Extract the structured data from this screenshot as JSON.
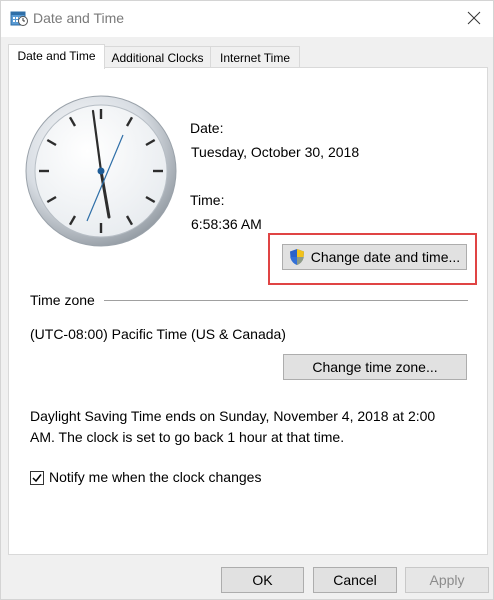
{
  "window": {
    "title": "Date and Time"
  },
  "tabs": [
    {
      "label": "Date and Time"
    },
    {
      "label": "Additional Clocks"
    },
    {
      "label": "Internet Time"
    }
  ],
  "date_section": {
    "date_label": "Date:",
    "date_value": "Tuesday, October 30, 2018",
    "time_label": "Time:",
    "time_value": "6:58:36 AM",
    "change_button": "Change date and time..."
  },
  "time_zone": {
    "heading": "Time zone",
    "value": "(UTC-08:00) Pacific Time (US & Canada)",
    "change_button": "Change time zone..."
  },
  "dst_message_line1": "Daylight Saving Time ends on Sunday, November 4, 2018 at 2:00",
  "dst_message_line2": "AM. The clock is set to go back 1 hour at that time.",
  "notify": {
    "label": "Notify me when the clock changes",
    "checked": true
  },
  "buttons": {
    "ok": "OK",
    "cancel": "Cancel",
    "apply": "Apply"
  },
  "highlight_color": "#e04444"
}
